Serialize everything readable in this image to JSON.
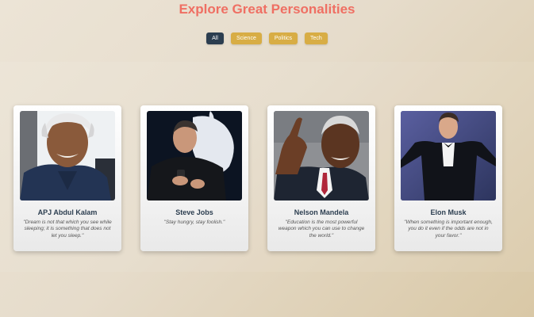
{
  "header": {
    "title": "Explore Great Personalities"
  },
  "filters": [
    {
      "label": "All",
      "active": true
    },
    {
      "label": "Science",
      "active": false
    },
    {
      "label": "Politics",
      "active": false
    },
    {
      "label": "Tech",
      "active": false
    }
  ],
  "cards": [
    {
      "name": "APJ Abdul Kalam",
      "quote": "\"Dream is not that which you see while sleeping; it is something that does not let you sleep.\""
    },
    {
      "name": "Steve Jobs",
      "quote": "\"Stay hungry, stay foolish.\""
    },
    {
      "name": "Nelson Mandela",
      "quote": "\"Education is the most powerful weapon which you can use to change the world.\""
    },
    {
      "name": "Elon Musk",
      "quote": "\"When something is important enough, you do it even if the odds are not in your favor.\""
    }
  ],
  "colors": {
    "accent": "#ef6f63",
    "active_filter": "#2c3e50",
    "filter": "#d8ad45"
  }
}
